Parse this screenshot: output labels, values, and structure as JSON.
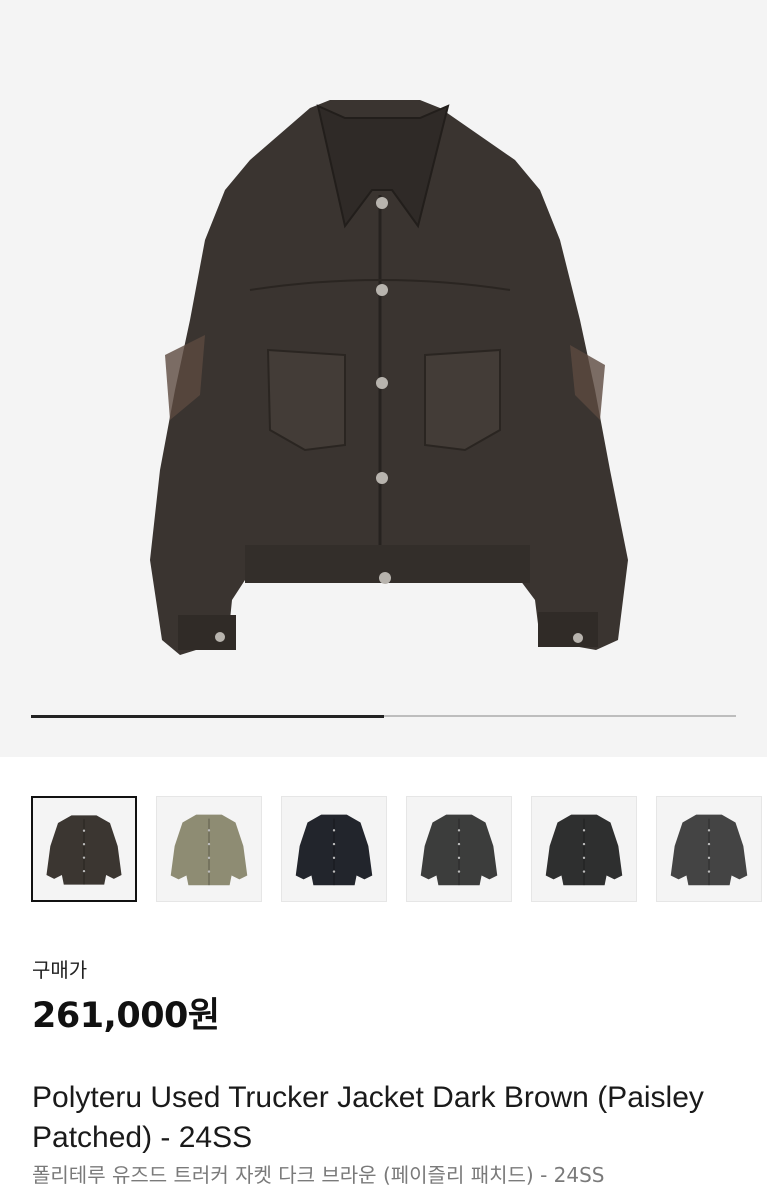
{
  "gallery": {
    "progress": 0.5,
    "thumbnails": [
      {
        "label": "dark-brown-jacket",
        "color": "#3b3631",
        "selected": true
      },
      {
        "label": "camo-jacket",
        "color": "#8e8c73",
        "selected": false
      },
      {
        "label": "black-navy-jacket",
        "color": "#22252c",
        "selected": false
      },
      {
        "label": "washed-black-jacket",
        "color": "#3c3d3c",
        "selected": false
      },
      {
        "label": "black-jacket",
        "color": "#2e2f2f",
        "selected": false
      },
      {
        "label": "charcoal-jacket",
        "color": "#444444",
        "selected": false
      }
    ]
  },
  "product": {
    "price_label": "구매가",
    "price": "261,000원",
    "title": "Polyteru Used Trucker Jacket Dark Brown (Paisley Patched) - 24SS",
    "subtitle": "폴리테루 유즈드 트러커 자켓 다크 브라운 (페이즐리 패치드) - 24SS"
  },
  "colors": {
    "hero_background": "#f4f4f4",
    "jacket_main": "#3a3430"
  }
}
